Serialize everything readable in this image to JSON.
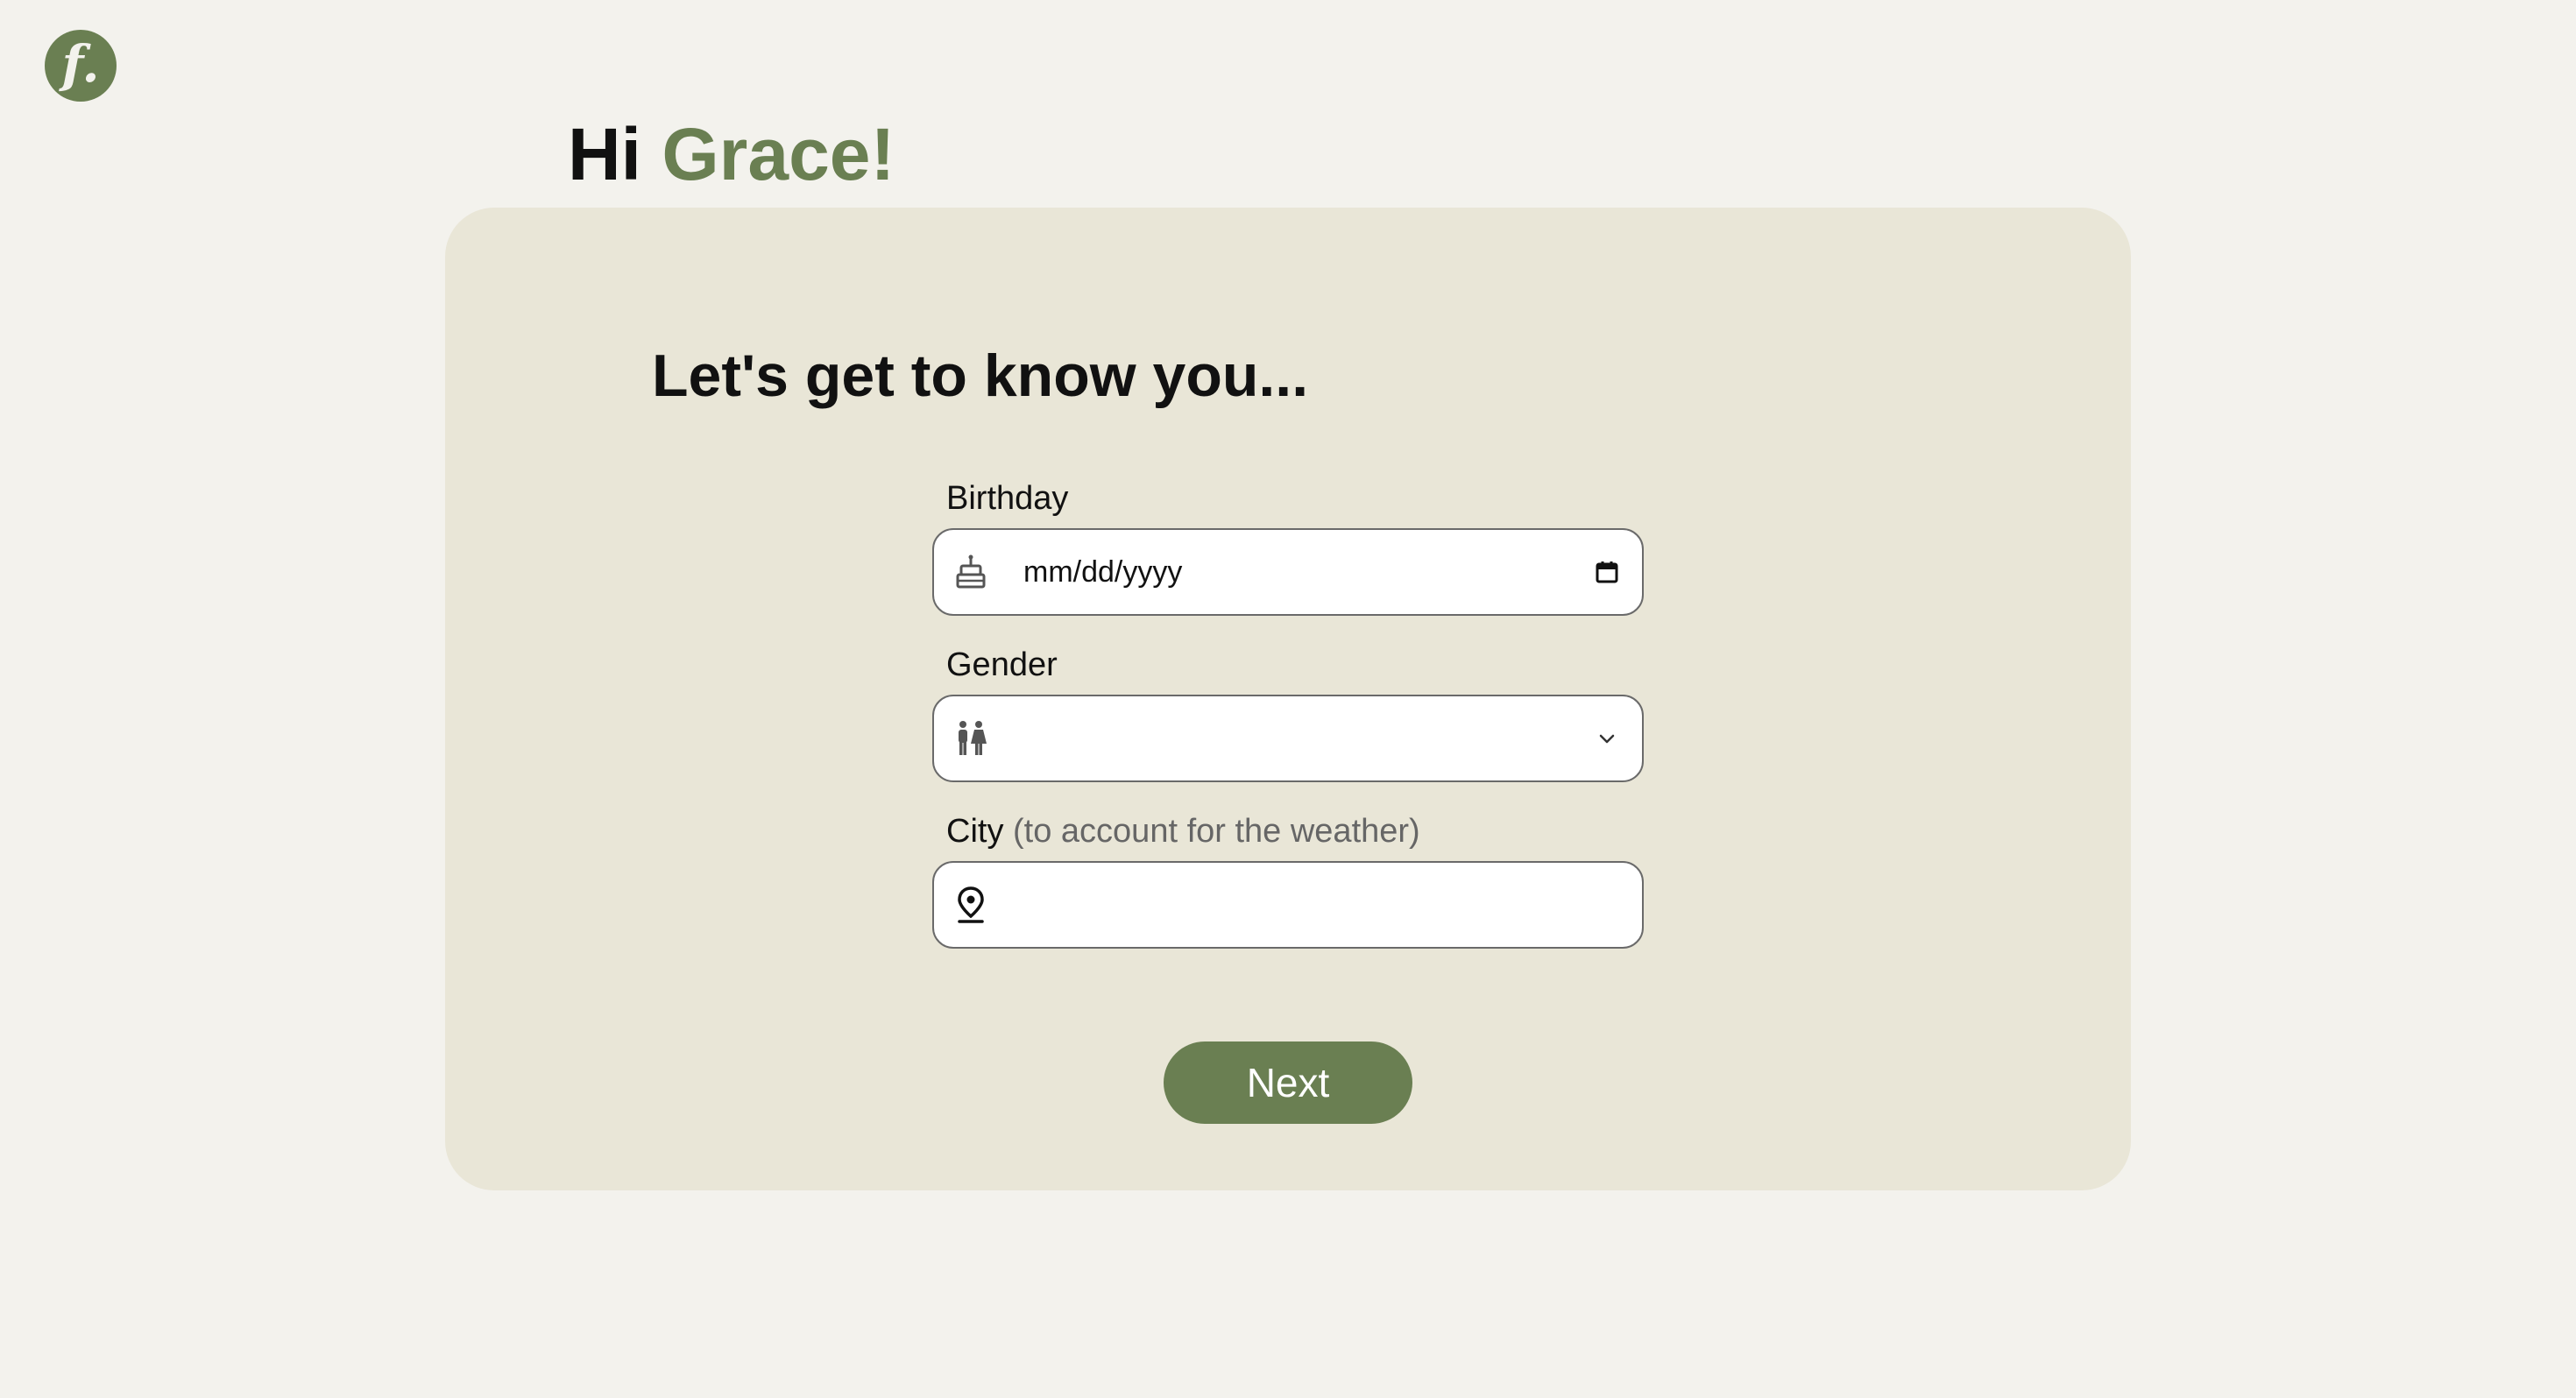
{
  "logo": {
    "letter": "f."
  },
  "greeting": {
    "prefix": "Hi ",
    "name": "Grace!"
  },
  "form": {
    "heading": "Let's get to know you...",
    "birthday": {
      "label": "Birthday",
      "placeholder": "mm/dd/yyyy",
      "icon": "cake-icon",
      "trailing_icon": "calendar-icon"
    },
    "gender": {
      "label": "Gender",
      "selected": "",
      "icon": "people-icon",
      "trailing_icon": "chevron-down-icon"
    },
    "city": {
      "label": "City",
      "hint": "(to account for the weather)",
      "value": "",
      "icon": "location-pin-icon"
    },
    "next_label": "Next"
  },
  "colors": {
    "background": "#f3f2ed",
    "card": "#e9e6d7",
    "accent": "#6a7f52"
  }
}
